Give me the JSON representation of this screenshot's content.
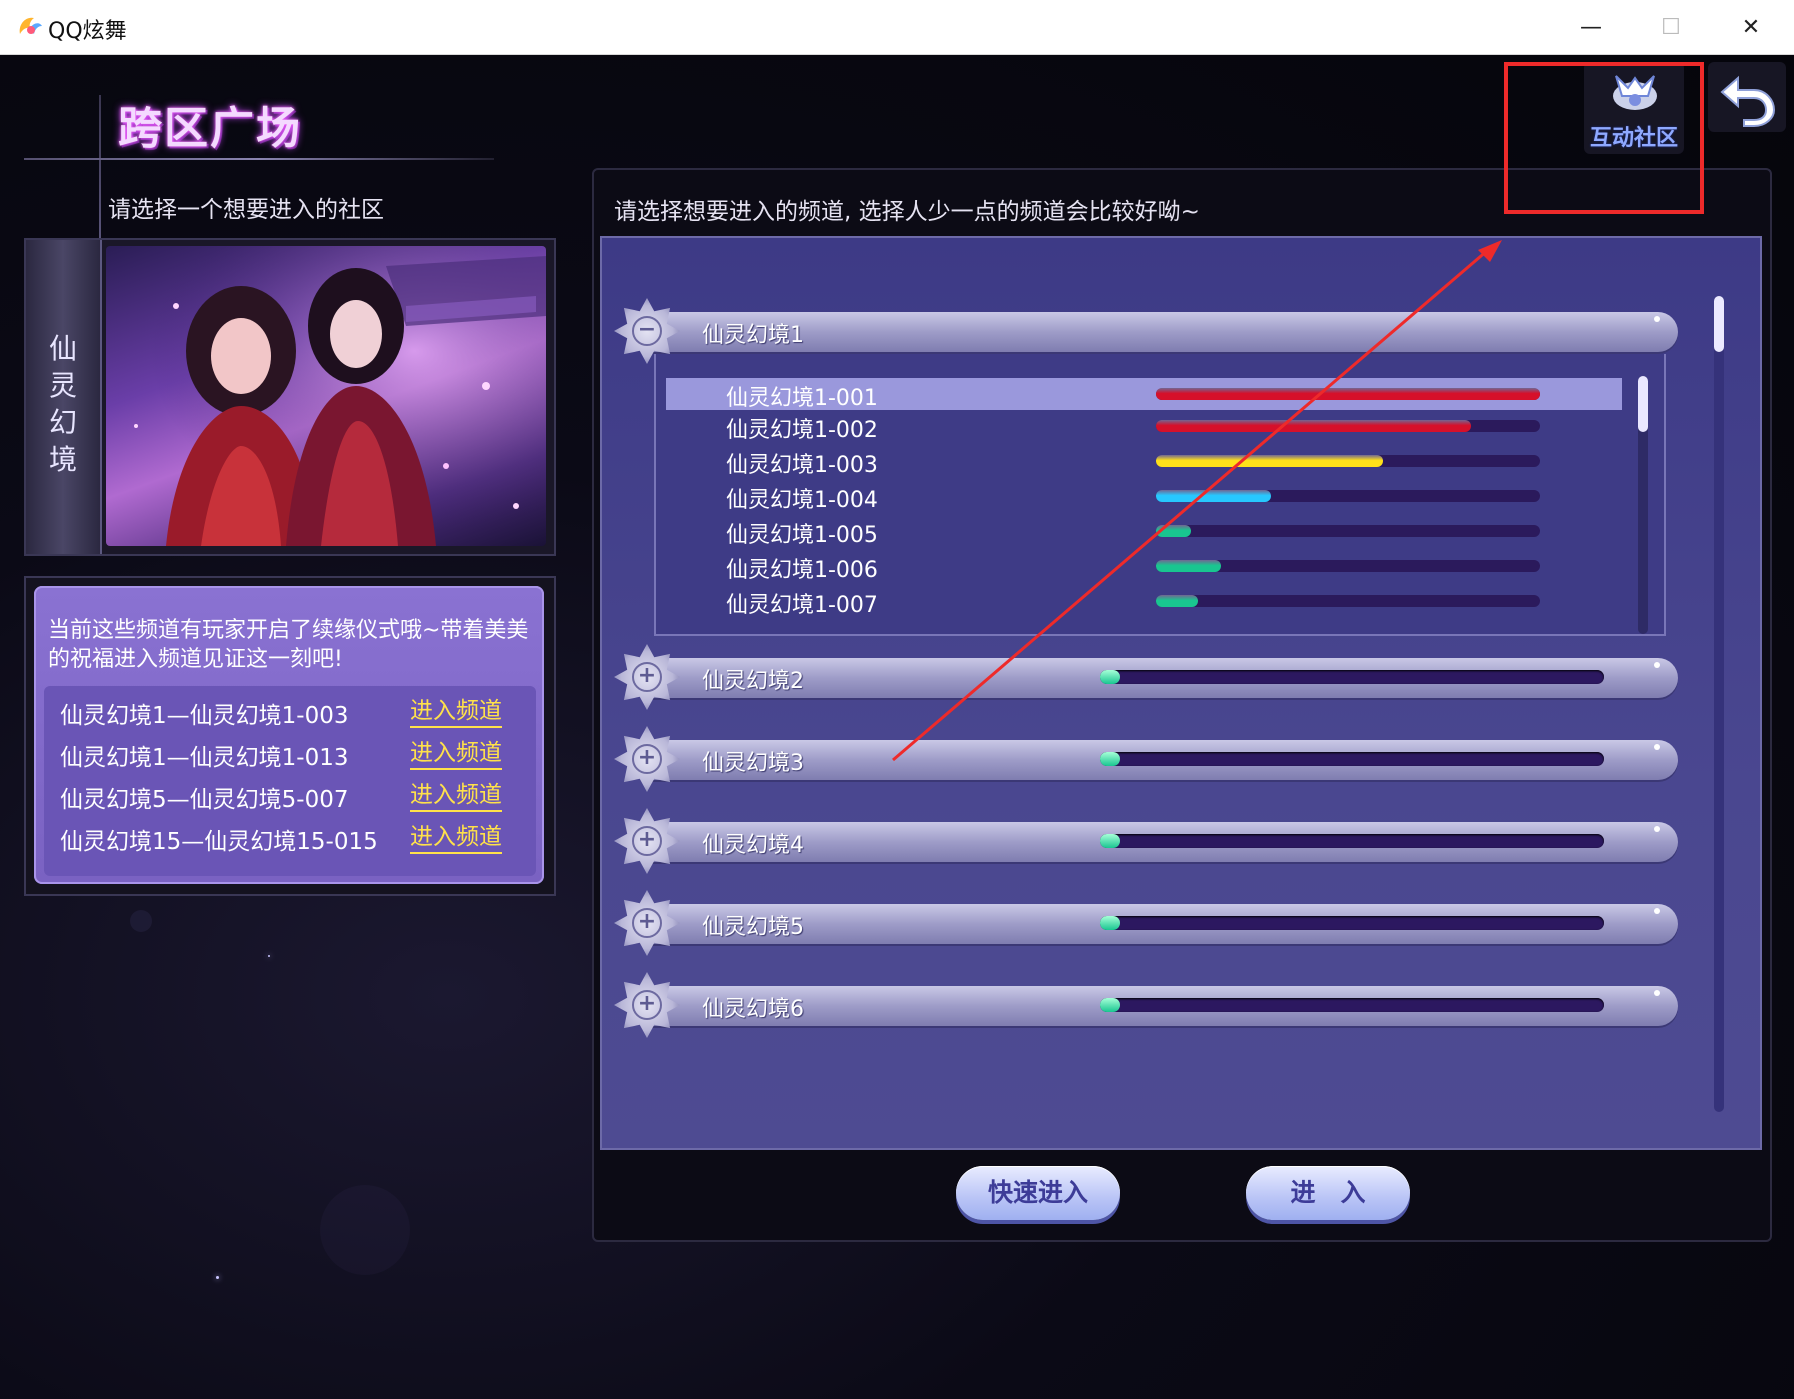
{
  "window": {
    "title": "QQ炫舞",
    "minimize_glyph": "—",
    "maximize_glyph": "☐",
    "close_glyph": "✕"
  },
  "header": {
    "title": "跨区广场",
    "subtitle": "请选择一个想要进入的社区"
  },
  "community": {
    "name": "仙灵幻境"
  },
  "notice": {
    "text": "当前这些频道有玩家开启了续缘仪式哦~带着美美的祝福进入频道见证这一刻吧!",
    "items": [
      {
        "channel": "仙灵幻境1—仙灵幻境1-003",
        "link": "进入频道"
      },
      {
        "channel": "仙灵幻境1—仙灵幻境1-013",
        "link": "进入频道"
      },
      {
        "channel": "仙灵幻境5—仙灵幻境5-007",
        "link": "进入频道"
      },
      {
        "channel": "仙灵幻境15—仙灵幻境15-015",
        "link": "进入频道"
      }
    ]
  },
  "channels": {
    "hint": "请选择想要进入的频道, 选择人少一点的频道会比较好呦~",
    "groups": [
      {
        "name": "仙灵幻境1",
        "expanded": true,
        "icon": "collapse-icon",
        "glyph": "−"
      },
      {
        "name": "仙灵幻境2",
        "expanded": false,
        "icon": "expand-icon",
        "glyph": "+",
        "load": 0.04
      },
      {
        "name": "仙灵幻境3",
        "expanded": false,
        "icon": "expand-icon",
        "glyph": "+",
        "load": 0.04
      },
      {
        "name": "仙灵幻境4",
        "expanded": false,
        "icon": "expand-icon",
        "glyph": "+",
        "load": 0.04
      },
      {
        "name": "仙灵幻境5",
        "expanded": false,
        "icon": "expand-icon",
        "glyph": "+",
        "load": 0.04
      },
      {
        "name": "仙灵幻境6",
        "expanded": false,
        "icon": "expand-icon",
        "glyph": "+",
        "load": 0.04
      }
    ],
    "subchannels": [
      {
        "name": "仙灵幻境1-001",
        "load": 1.0,
        "color": "#d6102a",
        "selected": true
      },
      {
        "name": "仙灵幻境1-002",
        "load": 0.82,
        "color": "#d6102a",
        "selected": false
      },
      {
        "name": "仙灵幻境1-003",
        "load": 0.59,
        "color": "#ffe11a",
        "selected": false
      },
      {
        "name": "仙灵幻境1-004",
        "load": 0.3,
        "color": "#27c8ff",
        "selected": false
      },
      {
        "name": "仙灵幻境1-005",
        "load": 0.09,
        "color": "#19c690",
        "selected": false
      },
      {
        "name": "仙灵幻境1-006",
        "load": 0.17,
        "color": "#19c690",
        "selected": false
      },
      {
        "name": "仙灵幻境1-007",
        "load": 0.11,
        "color": "#19c690",
        "selected": false
      }
    ]
  },
  "buttons": {
    "quick_enter": "快速进入",
    "enter": "进　入"
  },
  "topright": {
    "community_label": "互动社区",
    "community_icon": "community-icon",
    "back_icon": "back-arrow-icon"
  },
  "annotation": {
    "highlight_color": "#ee2a2a"
  }
}
